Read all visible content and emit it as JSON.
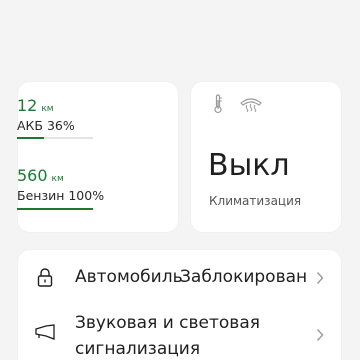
{
  "range": {
    "electric": {
      "value": "12",
      "unit": "км",
      "label": "АКБ 36%",
      "level_percent": 36,
      "color": "#1a7a34"
    },
    "fuel": {
      "value": "560",
      "unit": "км",
      "label": "Бензин 100%",
      "level_percent": 100,
      "color": "#1a7a34"
    }
  },
  "climate": {
    "icons": [
      "thermometer-icon",
      "rear-defrost-icon"
    ],
    "value": "Выкл",
    "label": "Климатизация"
  },
  "list": {
    "items": [
      {
        "icon": "padlock-icon",
        "label": "Автомобиль",
        "status": "Заблокирован"
      },
      {
        "icon": "horn-icon",
        "label_line1": "Звуковая и световая",
        "label_line2": "сигнализация"
      }
    ]
  },
  "colors": {
    "accent_green": "#1a7a34",
    "icon_gray": "#9a9a9a",
    "background": "#f4f4f4",
    "card": "#ffffff"
  }
}
